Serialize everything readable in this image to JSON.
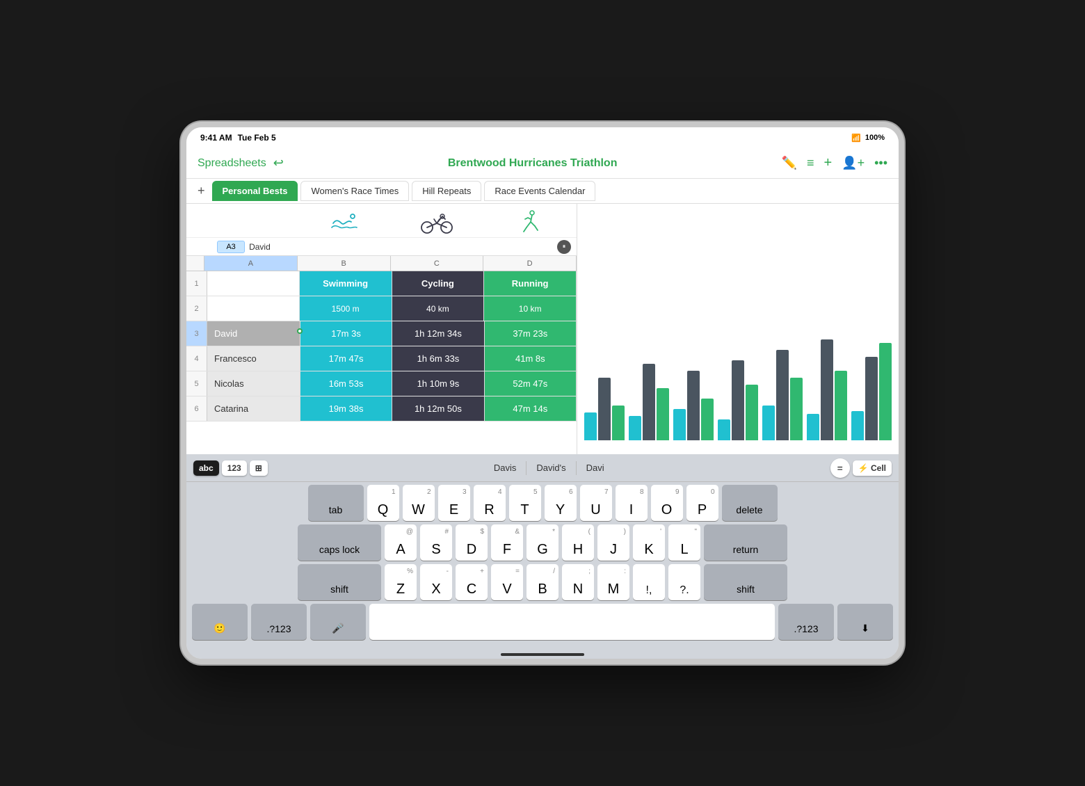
{
  "statusBar": {
    "time": "9:41 AM",
    "date": "Tue Feb 5",
    "wifi": true,
    "battery": "100%"
  },
  "toolbar": {
    "backLabel": "Spreadsheets",
    "title": "Brentwood Hurricanes Triathlon"
  },
  "tabs": [
    {
      "label": "Personal Bests",
      "active": true
    },
    {
      "label": "Women's Race Times",
      "active": false
    },
    {
      "label": "Hill Repeats",
      "active": false
    },
    {
      "label": "Race Events Calendar",
      "active": false
    }
  ],
  "spreadsheet": {
    "cellRef": "A3",
    "cellValue": "David",
    "columns": [
      "A",
      "B",
      "C",
      "D"
    ],
    "sports": {
      "swimming": "Swimming",
      "cycling": "Cycling",
      "running": "Running"
    },
    "distances": {
      "swim": "1500 m",
      "cycle": "40 km",
      "run": "10 km"
    },
    "rows": [
      {
        "num": 1,
        "name": "",
        "swim": "",
        "cycle": "",
        "run": ""
      },
      {
        "num": 2,
        "name": "",
        "swim": "1500 m",
        "cycle": "40 km",
        "run": "10 km"
      },
      {
        "num": 3,
        "name": "David",
        "swim": "17m 3s",
        "cycle": "1h 12m 34s",
        "run": "37m 23s",
        "selected": true
      },
      {
        "num": 4,
        "name": "Francesco",
        "swim": "17m 47s",
        "cycle": "1h 6m 33s",
        "run": "41m 8s"
      },
      {
        "num": 5,
        "name": "Nicolas",
        "swim": "16m 53s",
        "cycle": "1h 10m 9s",
        "run": "52m 47s"
      },
      {
        "num": 6,
        "name": "Catarina",
        "swim": "19m 38s",
        "cycle": "1h 12m 50s",
        "run": "47m 14s"
      }
    ]
  },
  "chart": {
    "bars": [
      {
        "swim": 40,
        "cycle": 90,
        "run": 50
      },
      {
        "swim": 35,
        "cycle": 110,
        "run": 75
      },
      {
        "swim": 45,
        "cycle": 100,
        "run": 60
      },
      {
        "swim": 30,
        "cycle": 115,
        "run": 80
      },
      {
        "swim": 50,
        "cycle": 130,
        "run": 90
      },
      {
        "swim": 38,
        "cycle": 145,
        "run": 100
      },
      {
        "swim": 42,
        "cycle": 120,
        "run": 140
      }
    ]
  },
  "keyboard": {
    "modeAbc": "abc",
    "mode123": "123",
    "autocomplete": [
      "Davis",
      "David's",
      "Davi"
    ],
    "cellLabel": "⚡ Cell",
    "rows": [
      {
        "keys": [
          {
            "label": "Q",
            "sub": "1"
          },
          {
            "label": "W",
            "sub": "2"
          },
          {
            "label": "E",
            "sub": "3"
          },
          {
            "label": "R",
            "sub": "4"
          },
          {
            "label": "T",
            "sub": "5"
          },
          {
            "label": "Y",
            "sub": "6"
          },
          {
            "label": "U",
            "sub": "7"
          },
          {
            "label": "I",
            "sub": "8"
          },
          {
            "label": "O",
            "sub": "9"
          },
          {
            "label": "P",
            "sub": "0"
          }
        ],
        "leftSpecial": "tab",
        "rightSpecial": "delete"
      },
      {
        "keys": [
          {
            "label": "A",
            "sub": "@"
          },
          {
            "label": "S",
            "sub": "#"
          },
          {
            "label": "D",
            "sub": "$"
          },
          {
            "label": "F",
            "sub": "&"
          },
          {
            "label": "G",
            "sub": "*"
          },
          {
            "label": "H",
            "sub": "("
          },
          {
            "label": "J",
            "sub": ")"
          },
          {
            "label": "K",
            "sub": "'"
          },
          {
            "label": "L",
            "sub": "\""
          }
        ],
        "leftSpecial": "caps lock",
        "rightSpecial": "return"
      },
      {
        "keys": [
          {
            "label": "Z",
            "sub": "%"
          },
          {
            "label": "X",
            "sub": "-"
          },
          {
            "label": "C",
            "sub": "+"
          },
          {
            "label": "V",
            "sub": "="
          },
          {
            "label": "B",
            "sub": "/"
          },
          {
            "label": "N",
            "sub": ";"
          },
          {
            "label": "M",
            "sub": ":"
          },
          {
            "label": "!",
            "sub": ""
          },
          {
            "label": "?",
            "sub": ""
          }
        ],
        "leftSpecial": "shift",
        "rightSpecial": "shift"
      }
    ],
    "bottomRow": {
      "emoji": "🙂",
      "dotLabel": ".?123",
      "mic": "🎤",
      "dotLabel2": ".?123",
      "hideKeyboard": "⬇"
    }
  }
}
